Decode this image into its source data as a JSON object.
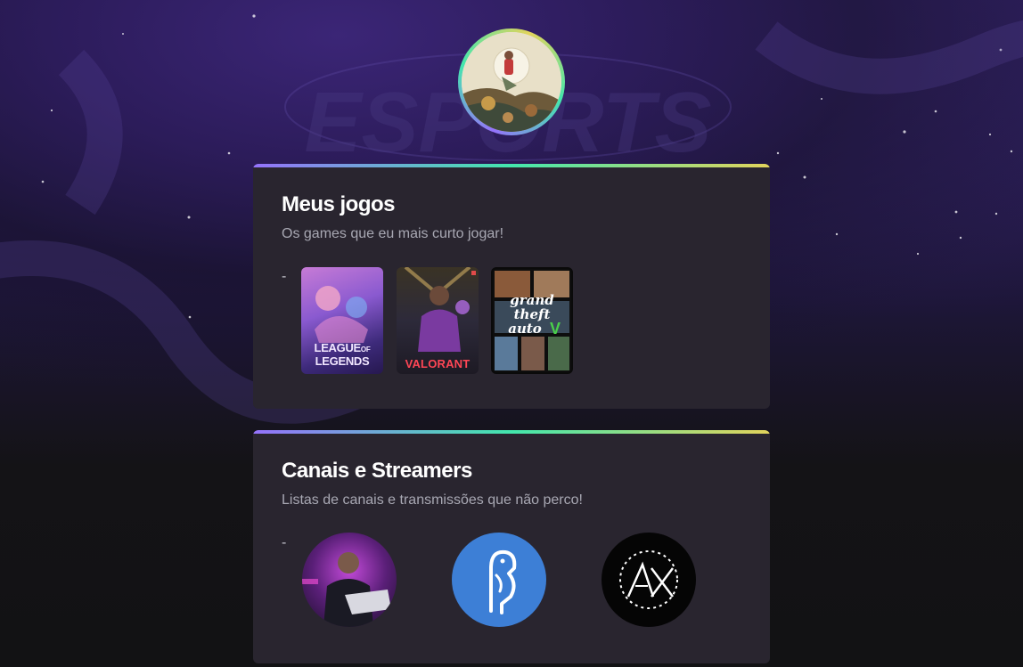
{
  "profile": {
    "avatar_alt": "avatar-art"
  },
  "sections": {
    "games": {
      "title": "Meus jogos",
      "subtitle": "Os games que eu mais curto jogar!",
      "bullet": "-",
      "items": [
        {
          "name": "League of Legends",
          "label_line1": "LEAGUE",
          "label_of": "OF",
          "label_line2": "LEGENDS"
        },
        {
          "name": "Valorant",
          "label": "VALORANT"
        },
        {
          "name": "Grand Theft Auto V",
          "label_line1": "grand",
          "label_line2": "theft",
          "label_line3": "auto",
          "label_numeral": "V"
        }
      ]
    },
    "channels": {
      "title": "Canais e Streamers",
      "subtitle": "Listas de canais e transmissões que não perco!",
      "bullet": "-",
      "items": [
        {
          "name": "streamer-1"
        },
        {
          "name": "streamer-2"
        },
        {
          "name": "streamer-3"
        }
      ]
    }
  },
  "colors": {
    "card_bg": "#29252f",
    "title": "#ffffff",
    "subtitle": "#a8a8b3",
    "gradient_start": "#9572fc",
    "gradient_mid": "#43e7ad",
    "gradient_end": "#e2d45c"
  }
}
